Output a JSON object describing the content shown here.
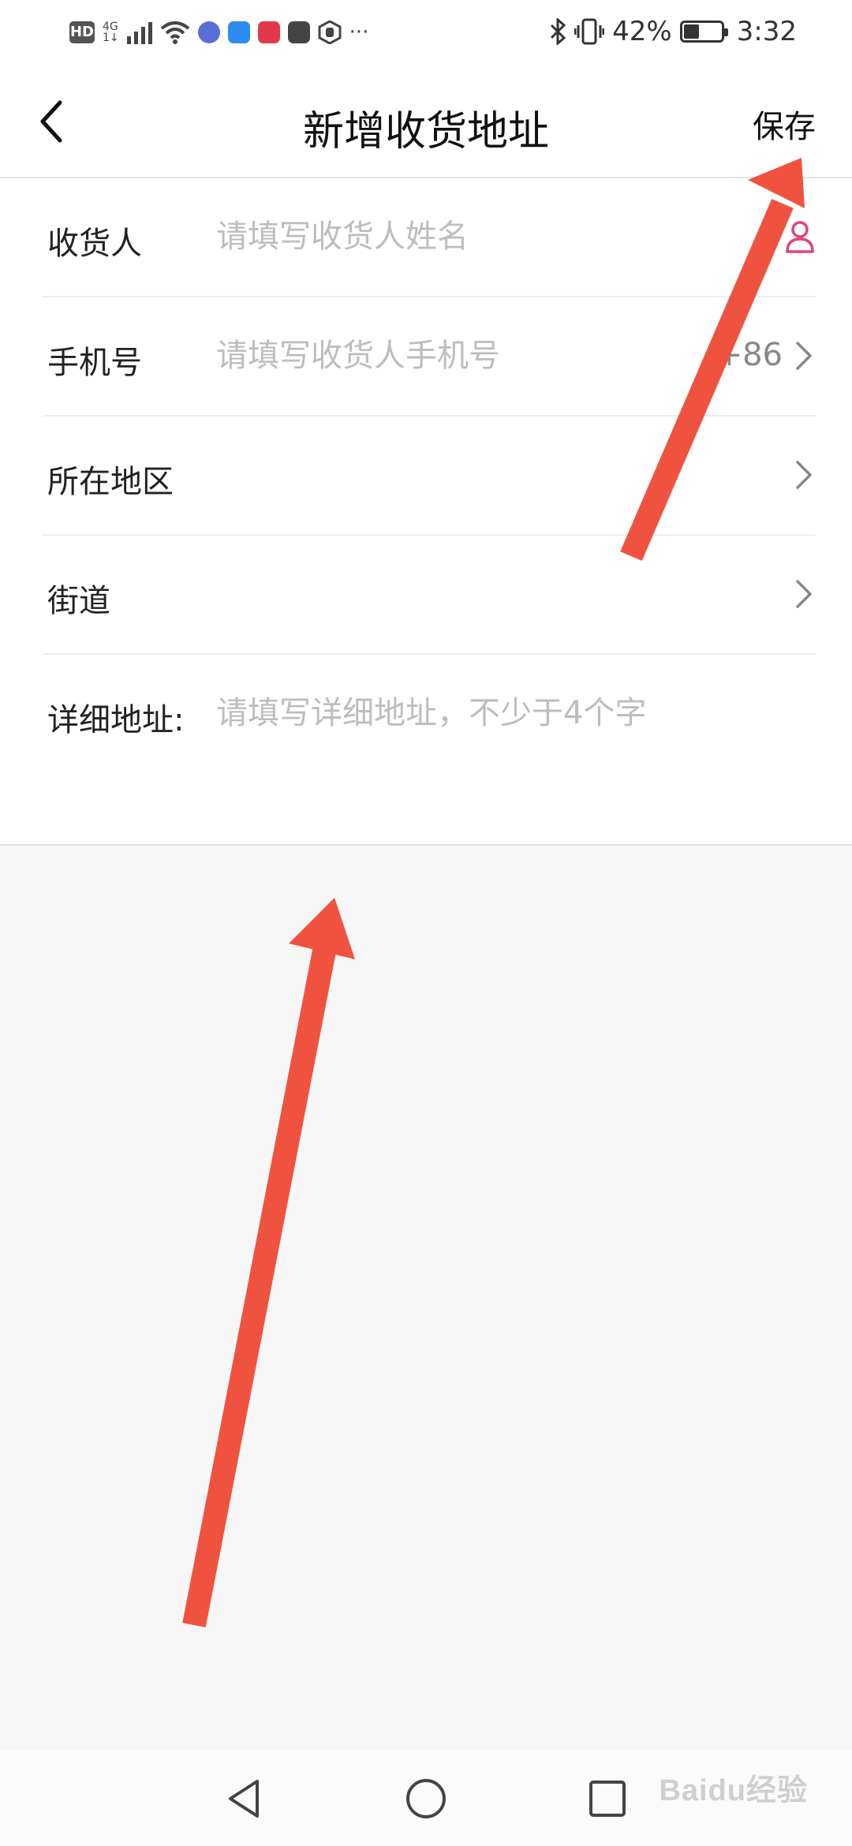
{
  "status_bar": {
    "hd": "HD",
    "network_top": "4G",
    "network_bottom": "1↓",
    "battery_text": "42%",
    "battery_level": 0.42,
    "time": "3:32",
    "more": "···"
  },
  "header": {
    "title": "新增收货地址",
    "save_label": "保存"
  },
  "form": {
    "rows": [
      {
        "label": "收货人",
        "placeholder": "请填写收货人姓名"
      },
      {
        "label": "手机号",
        "placeholder": "请填写收货人手机号",
        "suffix": "+86"
      },
      {
        "label": "所在地区"
      },
      {
        "label": "街道"
      },
      {
        "label": "详细地址:",
        "placeholder": "请填写详细地址，不少于4个字"
      }
    ]
  },
  "colors": {
    "accent_pink": "#e0457b",
    "annotation_red": "#ef5340"
  },
  "watermark": "Baidu经验"
}
